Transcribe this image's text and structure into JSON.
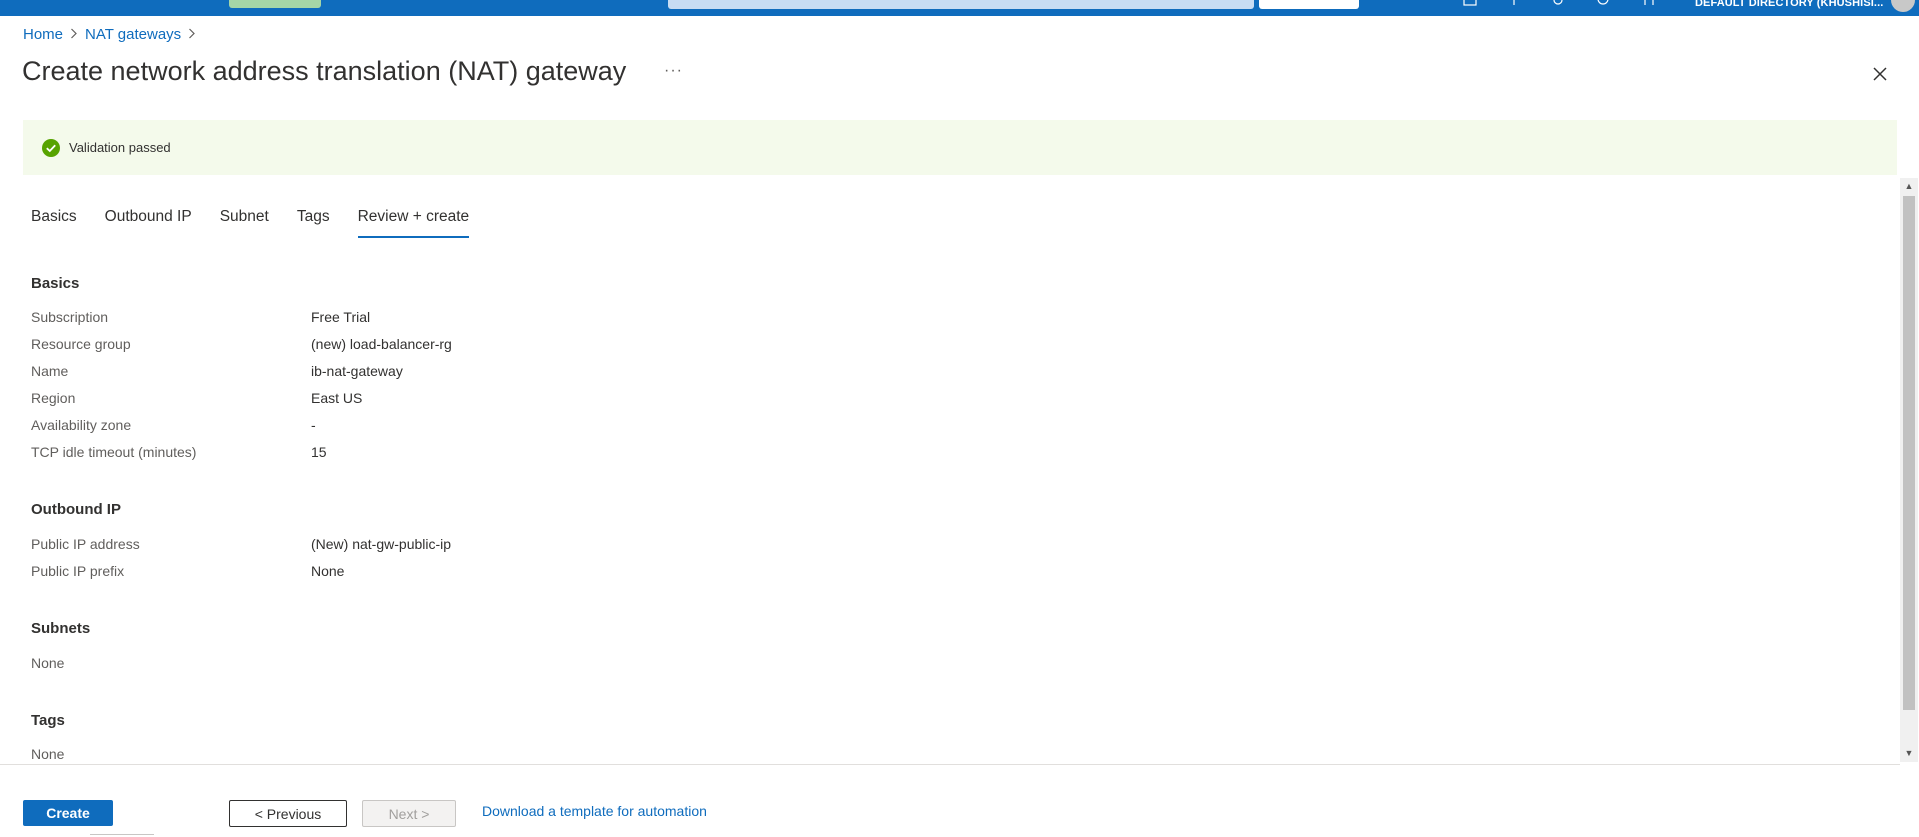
{
  "topbar": {
    "directory": "DEFAULT DIRECTORY (KHUSHISI..."
  },
  "breadcrumb": {
    "home": "Home",
    "nat_gateways": "NAT gateways",
    "sep": ">"
  },
  "page": {
    "title": "Create network address translation (NAT) gateway",
    "more": "···"
  },
  "validation": {
    "message": "Validation passed",
    "color": "#57a300"
  },
  "tabs": [
    {
      "label": "Basics"
    },
    {
      "label": "Outbound IP"
    },
    {
      "label": "Subnet"
    },
    {
      "label": "Tags"
    },
    {
      "label": "Review + create",
      "active": true
    }
  ],
  "review": {
    "basics": {
      "heading": "Basics",
      "rows": [
        {
          "label": "Subscription",
          "value": "Free Trial"
        },
        {
          "label": "Resource group",
          "value": "(new) load-balancer-rg"
        },
        {
          "label": "Name",
          "value": "ib-nat-gateway"
        },
        {
          "label": "Region",
          "value": "East US"
        },
        {
          "label": "Availability zone",
          "value": "-"
        },
        {
          "label": "TCP idle timeout (minutes)",
          "value": "15"
        }
      ]
    },
    "outbound_ip": {
      "heading": "Outbound IP",
      "rows": [
        {
          "label": "Public IP address",
          "value": "(New) nat-gw-public-ip"
        },
        {
          "label": "Public IP prefix",
          "value": "None"
        }
      ]
    },
    "subnets": {
      "heading": "Subnets",
      "value": "None"
    },
    "tags": {
      "heading": "Tags",
      "value": "None"
    }
  },
  "footer": {
    "create": "Create",
    "previous": "< Previous",
    "next": "Next >",
    "download": "Download a template for automation"
  },
  "colors": {
    "accent": "#0f6cbd",
    "success_bg": "#f4faeb"
  }
}
